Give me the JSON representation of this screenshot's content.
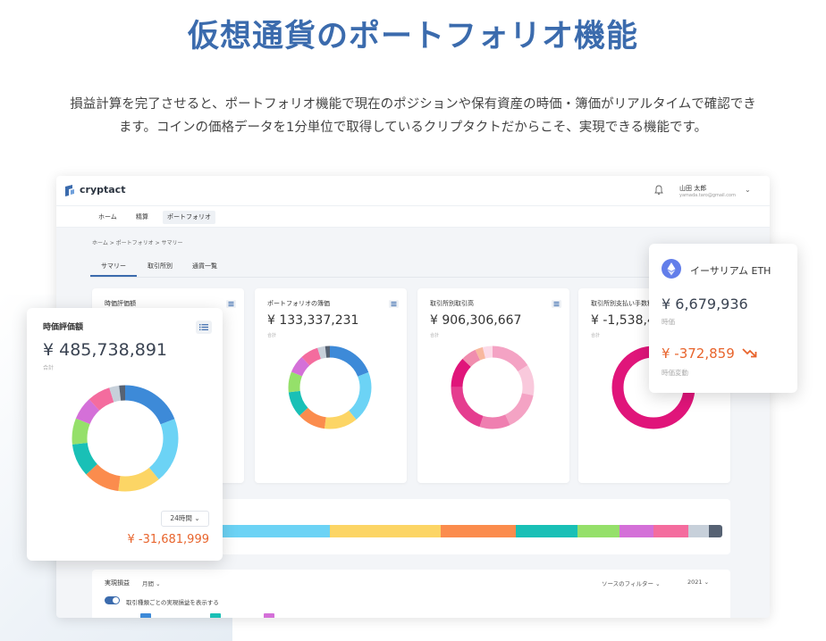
{
  "headline": "仮想通貨のポートフォリオ機能",
  "description": {
    "line1": "損益計算を完了させると、ポートフォリオ機能で現在のポジションや保有資産の時価・簿価がリアルタイムで確認でき",
    "line2": "ます。コインの価格データを1分単位で取得しているクリプタクトだからこそ、実現できる機能です。"
  },
  "app": {
    "logo": "cryptact",
    "user": {
      "name": "山田 太郎",
      "email": "yamada.taro@gmail.com"
    },
    "nav": [
      "ホーム",
      "精算",
      "ポートフォリオ"
    ],
    "breadcrumb": "ホーム > ポートフォリオ > サマリー",
    "subtabs": [
      "サマリー",
      "取引所別",
      "通貨一覧"
    ],
    "cards": [
      {
        "title": "時価評価額",
        "value": "",
        "sub": ""
      },
      {
        "title": "ポートフォリオの簿価",
        "value": "¥ 133,337,231",
        "sub": "合計"
      },
      {
        "title": "取引所別取引高",
        "value": "¥ 906,306,667",
        "sub": "合計"
      },
      {
        "title": "取引所別支払い手数料",
        "value": "¥ -1,538,4",
        "sub": "合計"
      }
    ],
    "realized": {
      "title": "実現損益",
      "period": "月間",
      "filter": "ソースのフィルター",
      "year": "2021",
      "toggle_label": "取引種類ごとの実現損益を表示する"
    }
  },
  "float_left": {
    "title": "時価評価額",
    "value": "¥ 485,738,891",
    "sub": "合計",
    "period_select": "24時間",
    "change": "¥ -31,681,999"
  },
  "float_right": {
    "coin": "イーサリアム ETH",
    "value": "¥ 6,679,936",
    "value_label": "時価",
    "change": "¥ -372,859",
    "change_label": "時価変動"
  },
  "colors": {
    "brand": "#3b6bad",
    "loss": "#e8642c",
    "eth": "#627eea"
  },
  "donuts": {
    "mix": [
      {
        "color": "#3d8ad8",
        "pct": 19
      },
      {
        "color": "#6cd3f5",
        "pct": 20
      },
      {
        "color": "#fcd565",
        "pct": 13
      },
      {
        "color": "#fb8c4d",
        "pct": 11
      },
      {
        "color": "#19c0b6",
        "pct": 10
      },
      {
        "color": "#95e06a",
        "pct": 8
      },
      {
        "color": "#d470d8",
        "pct": 7
      },
      {
        "color": "#f46c9e",
        "pct": 7
      },
      {
        "color": "#c7d0da",
        "pct": 3
      },
      {
        "color": "#566273",
        "pct": 2
      }
    ],
    "pink": [
      {
        "color": "#f4a3c4",
        "pct": 16
      },
      {
        "color": "#f9c9dc",
        "pct": 12
      },
      {
        "color": "#f4a3c4",
        "pct": 15
      },
      {
        "color": "#ef7fb0",
        "pct": 12
      },
      {
        "color": "#e53d8f",
        "pct": 20
      },
      {
        "color": "#e0157a",
        "pct": 12
      },
      {
        "color": "#f08dae",
        "pct": 6
      },
      {
        "color": "#f8b89e",
        "pct": 3
      },
      {
        "color": "#fcdbe8",
        "pct": 4
      }
    ],
    "magenta": [
      {
        "color": "#e0157a",
        "pct": 100
      }
    ]
  },
  "stacked_bar": [
    {
      "color": "#3d8ad8",
      "pct": 8
    },
    {
      "color": "#6cd3f5",
      "pct": 23
    },
    {
      "color": "#fcd565",
      "pct": 16
    },
    {
      "color": "#fb8c4d",
      "pct": 11
    },
    {
      "color": "#19c0b6",
      "pct": 9
    },
    {
      "color": "#95e06a",
      "pct": 6
    },
    {
      "color": "#d470d8",
      "pct": 5
    },
    {
      "color": "#f46c9e",
      "pct": 5
    },
    {
      "color": "#c7d0da",
      "pct": 3
    },
    {
      "color": "#566273",
      "pct": 2
    }
  ]
}
